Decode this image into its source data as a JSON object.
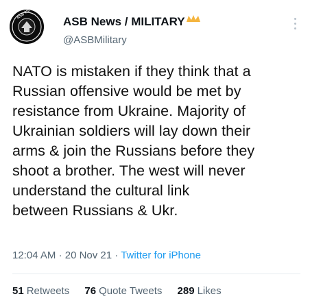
{
  "account": {
    "display_name": "ASB News / MILITARY",
    "handle": "@ASBMilitary",
    "avatar_text": "ASB NEWS MILITARY"
  },
  "tweet": {
    "text": "NATO is mistaken if they think that a\nRussian offensive would be met by\nresistance from Ukraine. Majority of\nUkrainian soldiers will lay down their\narms & join the Russians before they\nshoot a brother. The west will never\nunderstand the cultural link\nbetween Russians & Ukr.",
    "time": "12:04 AM",
    "date": "20 Nov 21",
    "separator": "·",
    "source": "Twitter for iPhone"
  },
  "stats": {
    "retweets_count": "51",
    "retweets_label": "Retweets",
    "quotes_count": "76",
    "quotes_label": "Quote Tweets",
    "likes_count": "289",
    "likes_label": "Likes"
  },
  "colors": {
    "text": "#0f1419",
    "secondary": "#536471",
    "link": "#1d9bf0",
    "badge": "#f5b53f"
  },
  "icons": {
    "badge": "crown-icon",
    "more": "more-vertical-icon"
  }
}
